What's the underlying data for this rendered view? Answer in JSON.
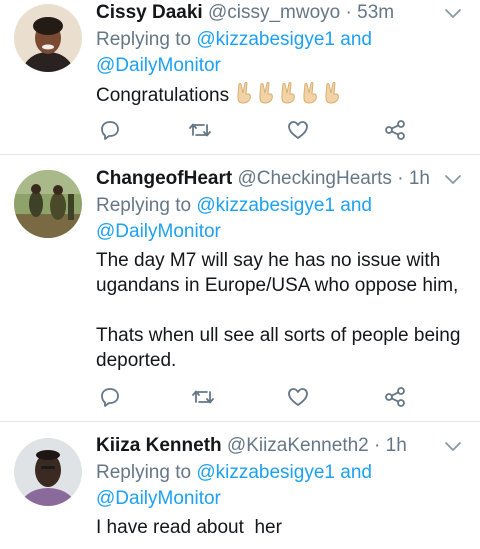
{
  "colors": {
    "accent": "#1da1f2",
    "muted": "#657786",
    "text": "#14171a",
    "divider": "#e1e8ed",
    "emoji": "#f2d3a6"
  },
  "tweets": [
    {
      "display_name": "Cissy Daaki",
      "handle": "@cissy_mwoyo",
      "separator": " · ",
      "time": "53m",
      "replying_prefix": "Replying to ",
      "mention_1": "@kizzabesigye1",
      "replying_and": " and",
      "mention_2": "@DailyMonitor",
      "text": "Congratulations",
      "emoji": [
        "victory-hand",
        "victory-hand",
        "victory-hand",
        "victory-hand",
        "victory-hand"
      ],
      "icons": [
        "reply-icon",
        "retweet-icon",
        "like-icon",
        "share-icon",
        "chevron-down-icon"
      ]
    },
    {
      "display_name": "ChangeofHeart",
      "handle": "@CheckingHearts",
      "separator": " · ",
      "time": "1h",
      "replying_prefix": "Replying to ",
      "mention_1": "@kizzabesigye1",
      "replying_and": " and",
      "mention_2": "@DailyMonitor",
      "lines": [
        "The day M7 will say he has no issue with",
        "ugandans in Europe/USA who oppose him,",
        "",
        "Thats when ull see all sorts of people being",
        "deported."
      ]
    },
    {
      "display_name": "Kiiza Kenneth",
      "handle": "@KiizaKenneth2",
      "separator": " · ",
      "time": "1h",
      "replying_prefix": "Replying to ",
      "mention_1": "@kizzabesigye1",
      "replying_and": " and",
      "mention_2": "@DailyMonitor",
      "text": "I have read about  her"
    }
  ]
}
